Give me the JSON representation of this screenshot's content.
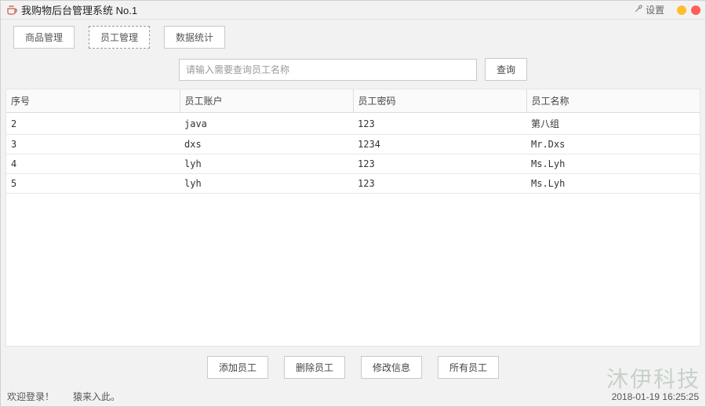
{
  "titlebar": {
    "title": "我购物后台管理系统 No.1",
    "settings_label": "设置"
  },
  "nav": {
    "items": [
      {
        "label": "商品管理",
        "active": false
      },
      {
        "label": "员工管理",
        "active": true
      },
      {
        "label": "数据统计",
        "active": false
      }
    ]
  },
  "search": {
    "placeholder": "请输入需要查询员工名称",
    "button_label": "查询"
  },
  "table": {
    "headers": {
      "id": "序号",
      "account": "员工账户",
      "password": "员工密码",
      "name": "员工名称"
    },
    "rows": [
      {
        "id": "2",
        "account": "java",
        "password": "123",
        "name": "第八组"
      },
      {
        "id": "3",
        "account": "dxs",
        "password": "1234",
        "name": "Mr.Dxs"
      },
      {
        "id": "4",
        "account": "lyh",
        "password": "123",
        "name": "Ms.Lyh"
      },
      {
        "id": "5",
        "account": "lyh",
        "password": "123",
        "name": "Ms.Lyh"
      }
    ]
  },
  "actions": {
    "add": "添加员工",
    "del": "删除员工",
    "edit": "修改信息",
    "all": "所有员工"
  },
  "footer": {
    "welcome": "欢迎登录！",
    "tagline": "猿来入此。",
    "timestamp": "2018-01-19 16:25:25"
  },
  "watermark": "沐伊科技"
}
